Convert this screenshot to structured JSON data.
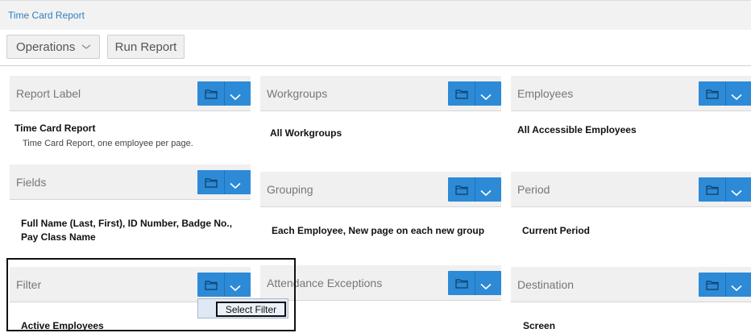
{
  "window": {
    "title": "Time Card Report"
  },
  "toolbar": {
    "operations_label": "Operations",
    "run_label": "Run Report"
  },
  "cards": {
    "report_label": {
      "label": "Report Label",
      "value": "Time Card Report",
      "description": "Time Card Report, one employee per page."
    },
    "workgroups": {
      "label": "Workgroups",
      "value": "All Workgroups"
    },
    "employees": {
      "label": "Employees",
      "value": "All Accessible Employees"
    },
    "fields": {
      "label": "Fields",
      "value_line1": "Full Name (Last, First), ID Number, Badge No.,",
      "value_line2": "Pay Class Name"
    },
    "grouping": {
      "label": "Grouping",
      "value": "Each Employee, New page on each new group"
    },
    "period": {
      "label": "Period",
      "value": "Current Period"
    },
    "filter": {
      "label": "Filter",
      "value": "Active Employees"
    },
    "attendance_exceptions": {
      "label": "Attendance Exceptions"
    },
    "destination": {
      "label": "Destination",
      "value": "Screen"
    }
  },
  "dropdown": {
    "select_filter_label": "Select Filter"
  },
  "colors": {
    "accent": "#2d8ad6",
    "title": "#2f7fbf",
    "header_bg": "#f0f0f0"
  },
  "icons": {
    "card_button_left": "folder-icon",
    "card_button_right": "chevron-down-icon"
  }
}
